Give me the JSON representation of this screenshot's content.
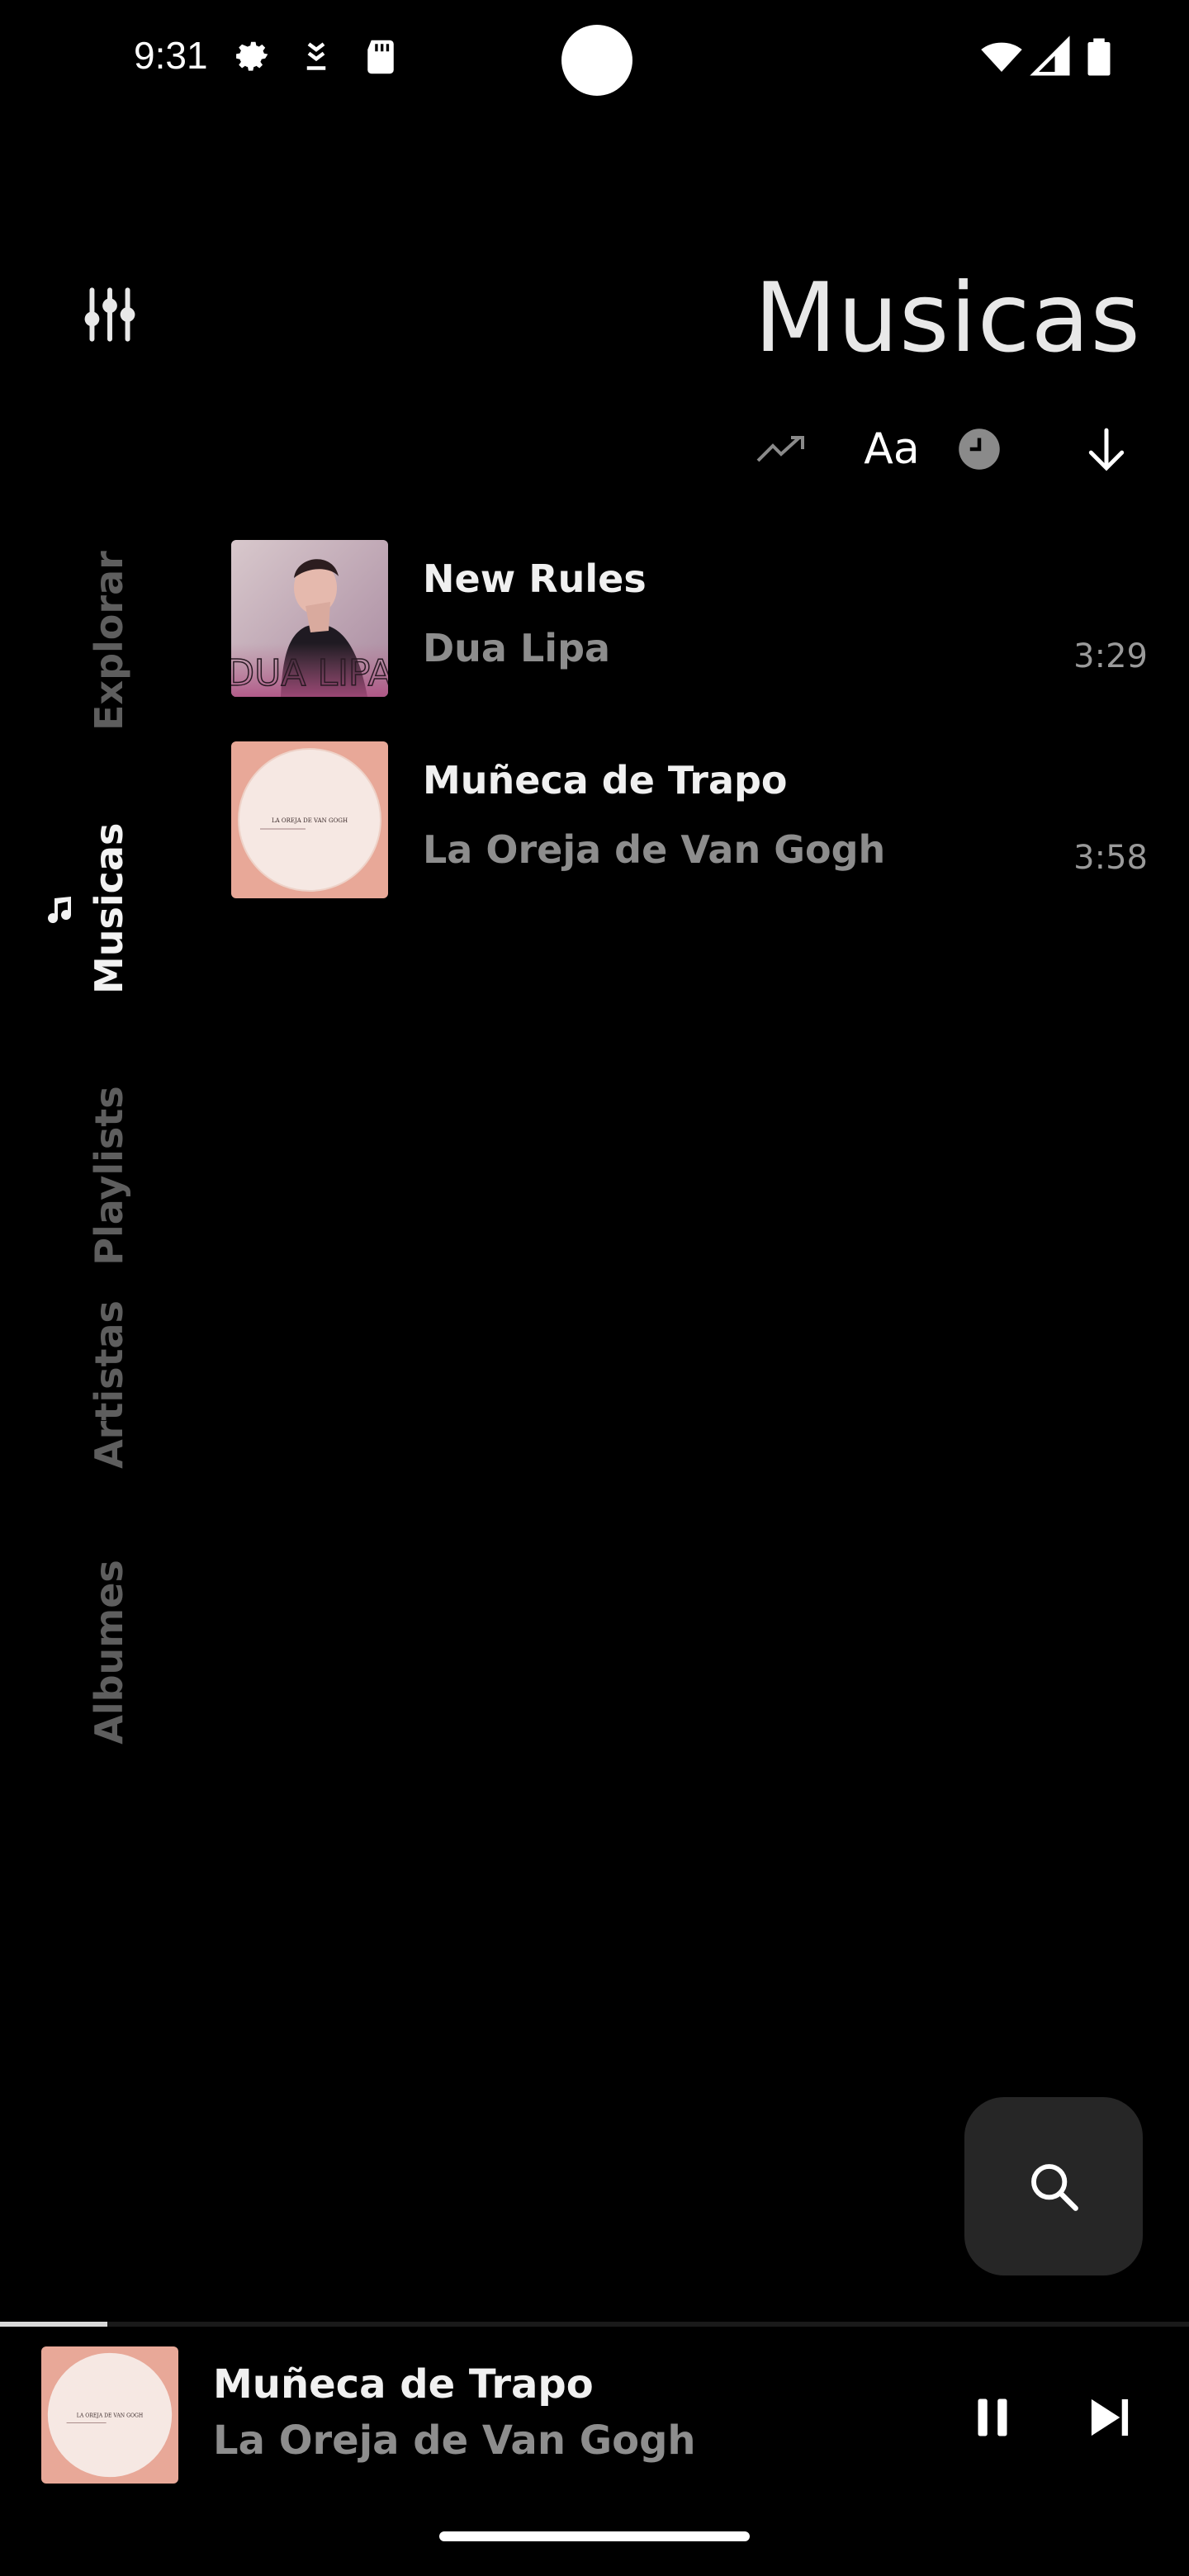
{
  "status_bar": {
    "time": "9:31",
    "icons": [
      "settings-gear-icon",
      "download-app-icon",
      "sd-card-icon",
      "wifi-icon",
      "cellular-signal-icon",
      "battery-icon"
    ]
  },
  "header": {
    "title": "Musicas",
    "sort_options": [
      {
        "name": "trending-icon",
        "label": ""
      },
      {
        "name": "alphabetical",
        "label": "Aa"
      },
      {
        "name": "clock-icon",
        "label": ""
      },
      {
        "name": "arrow-down-icon",
        "label": ""
      }
    ]
  },
  "nav": {
    "items": [
      {
        "label": "Explorar",
        "active": false
      },
      {
        "label": "Musicas",
        "active": true
      },
      {
        "label": "Playlists",
        "active": false
      },
      {
        "label": "Artistas",
        "active": false
      },
      {
        "label": "Albumes",
        "active": false
      }
    ]
  },
  "songs": [
    {
      "title": "New Rules",
      "artist": "Dua Lipa",
      "duration": "3:29",
      "art_text": "DUA LIPA"
    },
    {
      "title": "Muñeca de Trapo",
      "artist": "La Oreja de Van Gogh",
      "duration": "3:58",
      "art_text": "LA OREJA DE VAN GOGH"
    }
  ],
  "player": {
    "title": "Muñeca de Trapo",
    "artist": "La Oreja de Van Gogh",
    "art_text": "LA OREJA DE VAN GOGH",
    "progress": 0.09
  },
  "colors": {
    "background": "#000000",
    "text_primary": "#f0f0f0",
    "text_secondary": "#8d8d8d",
    "nav_inactive": "#5e5e5e",
    "fab_bg": "#262626",
    "album_pink": "#e8a898"
  }
}
